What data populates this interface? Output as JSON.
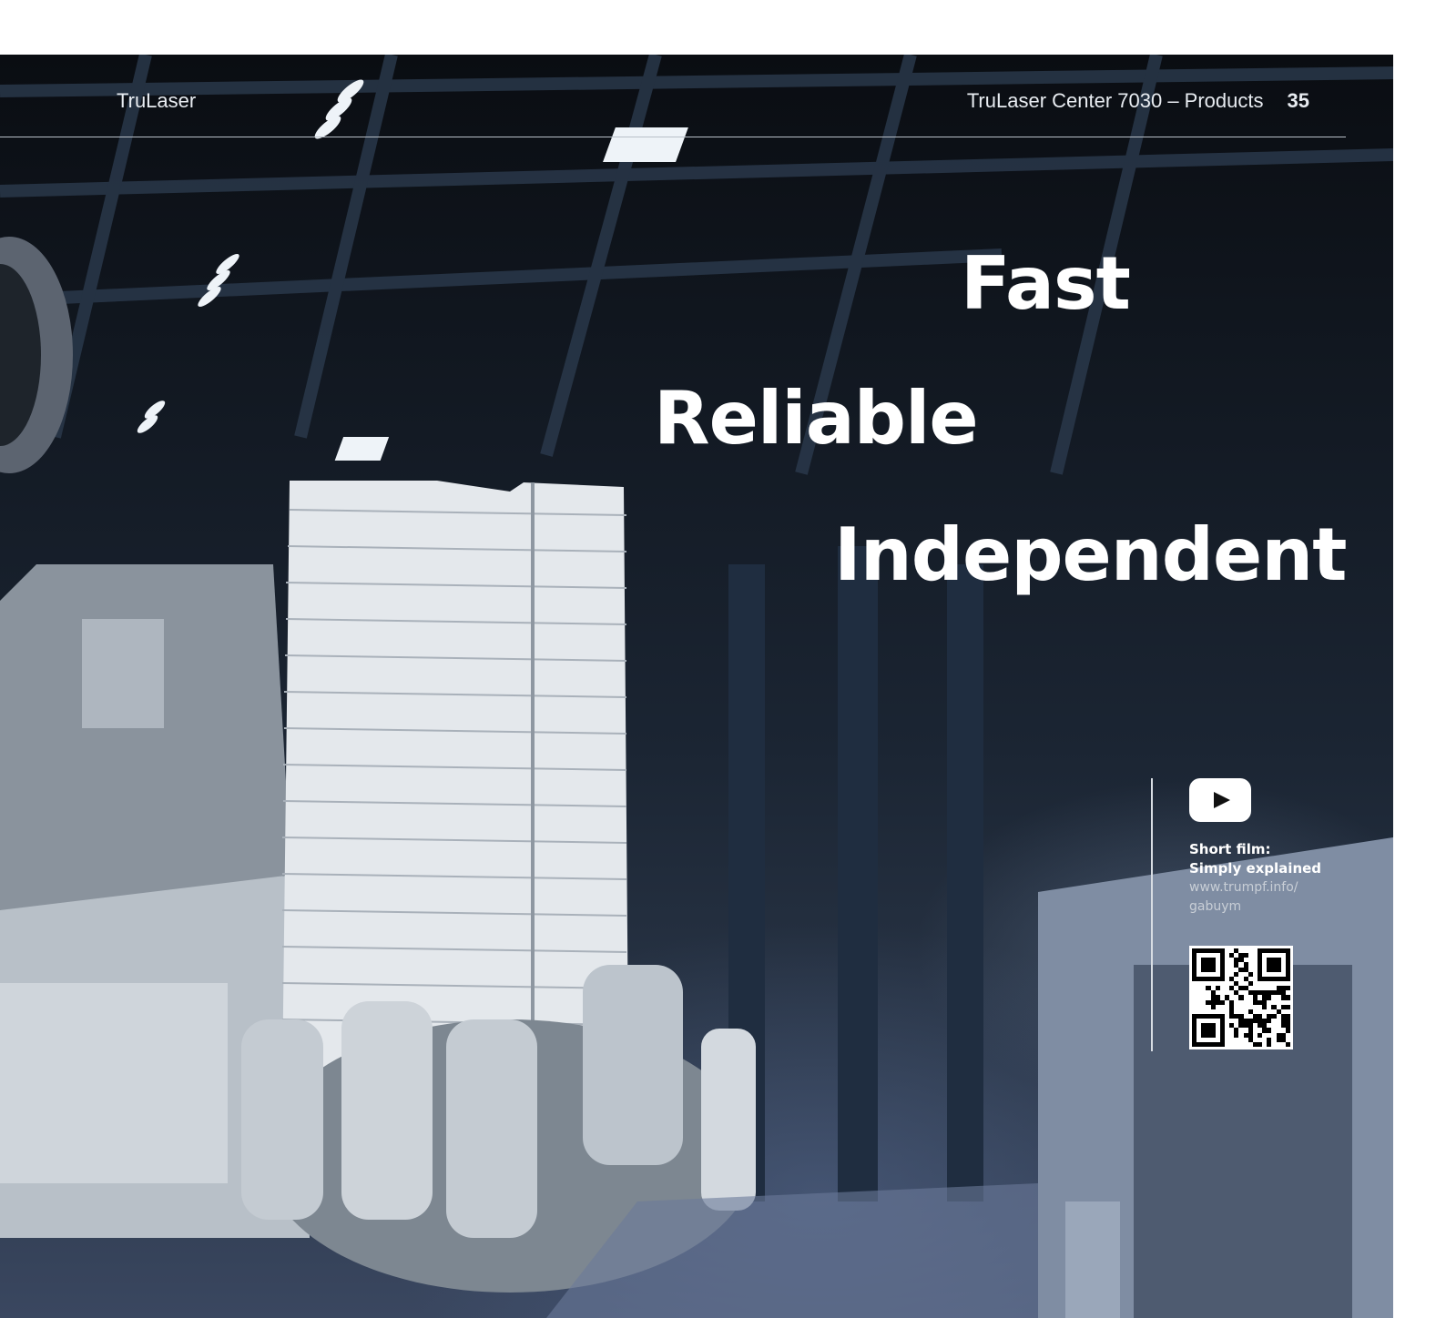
{
  "header": {
    "section": "TruLaser",
    "chapter": "TruLaser Center 7030 – Products",
    "page_number": "35"
  },
  "headlines": {
    "line1": "Fast",
    "line2": "Reliable",
    "line3": "Independent"
  },
  "video": {
    "icon": "youtube-play-icon",
    "title_line1": "Short film:",
    "title_line2": "Simply explained",
    "url_line1": "www.trumpf.info/",
    "url_line2": "gabuym",
    "qr_icon": "qr-code-icon"
  },
  "colors": {
    "background_dark": "#131a24",
    "text": "#ffffff",
    "rule": "#b9c0c8"
  }
}
